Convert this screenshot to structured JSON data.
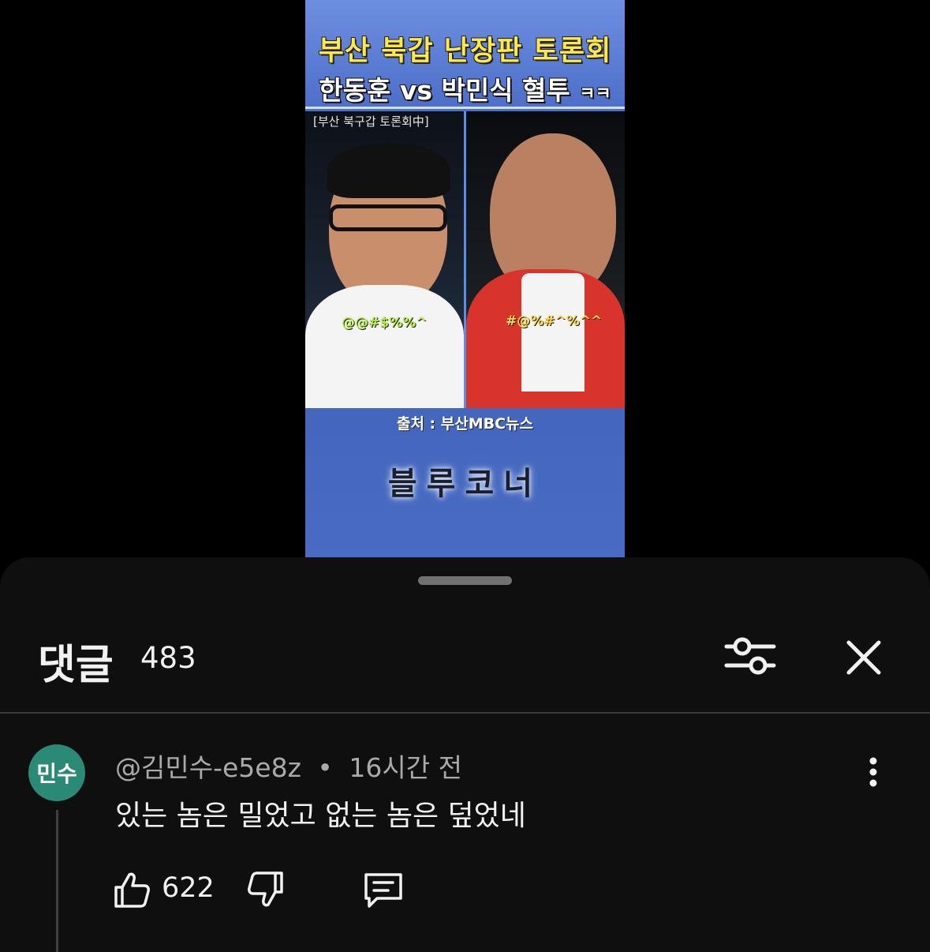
{
  "video": {
    "title_line1": "부산 북갑 난장판 토론회",
    "title_line2_main": "한동훈 vs 박민식 혈투",
    "title_line2_suffix": "ㅋㅋ",
    "caption_tag": "[부산 북구갑 토론회中]",
    "left_bubble": "@@#$%%^",
    "right_bubble": "#@%#^%^^",
    "source": "출처 : 부산MBC뉴스",
    "channel": "블루코너"
  },
  "comments_sheet": {
    "title": "댓글",
    "count": "483",
    "filter_icon": "sliders-icon",
    "close_icon": "close-icon"
  },
  "comment": {
    "avatar_text": "민수",
    "avatar_color": "#2a8a76",
    "author": "@김민수-e5e8z",
    "separator": "•",
    "time": "16시간 전",
    "text": "있는 놈은 밀었고 없는 놈은 덮었네",
    "like_count": "622",
    "like_icon": "thumbs-up-icon",
    "dislike_icon": "thumbs-down-icon",
    "reply_icon": "reply-icon",
    "more_icon": "more-vertical-icon"
  }
}
